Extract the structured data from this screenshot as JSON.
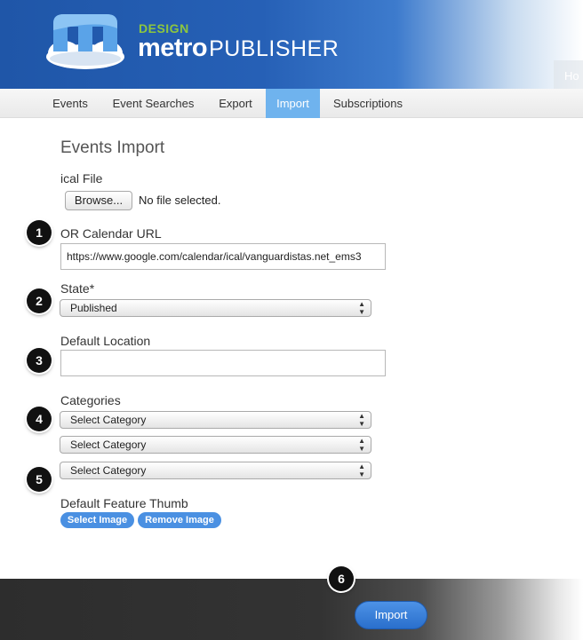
{
  "brand": {
    "design": "DESIGN",
    "name_bold": "metro",
    "name_regular": "PUBLISHER",
    "home_tab": "Ho"
  },
  "nav": {
    "items": [
      {
        "label": "Events"
      },
      {
        "label": "Event Searches"
      },
      {
        "label": "Export"
      },
      {
        "label": "Import"
      },
      {
        "label": "Subscriptions"
      }
    ],
    "active": "Import"
  },
  "form": {
    "title": "Events Import",
    "ical_label": "ical File",
    "browse_label": "Browse...",
    "file_status": "No file selected.",
    "url_label": "OR Calendar URL",
    "url_value": "https://www.google.com/calendar/ical/vanguardistas.net_ems3",
    "state_label": "State*",
    "state_value": "Published",
    "location_label": "Default Location",
    "location_value": "",
    "categories_label": "Categories",
    "category_selects": [
      "Select Category",
      "Select Category",
      "Select Category"
    ],
    "thumb_label": "Default Feature Thumb",
    "select_image_label": "Select Image",
    "remove_image_label": "Remove Image"
  },
  "steps": [
    "1",
    "2",
    "3",
    "4",
    "5",
    "6"
  ],
  "footer": {
    "import_label": "Import"
  },
  "colors": {
    "header_blue": "#2660b6",
    "brand_green": "#8dc63f",
    "nav_active": "#6fb3ee",
    "button_blue": "#4a90e2"
  }
}
